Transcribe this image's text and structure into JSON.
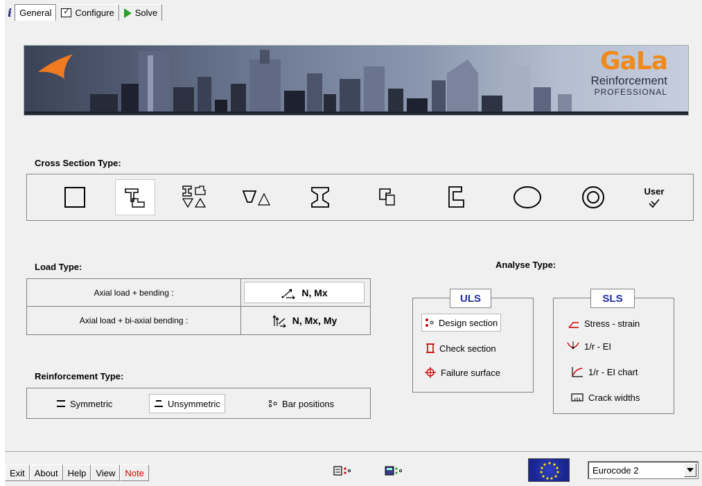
{
  "tabs": {
    "info_glyph": "i",
    "items": [
      {
        "label": "General",
        "icon": "none"
      },
      {
        "label": "Configure",
        "icon": "checklist-icon"
      },
      {
        "label": "Solve",
        "icon": "play-icon"
      }
    ]
  },
  "banner": {
    "brand_name": "GaLa",
    "brand_line1": "Reinforcement",
    "brand_line2": "PROFESSIONAL"
  },
  "cross_section": {
    "title": "Cross Section Type:",
    "user_label": "User",
    "items": [
      "rectangle-section-icon",
      "t-section-icon",
      "multi-section-icon",
      "trapezoid-section-icon",
      "i-section-icon",
      "box-section-icon",
      "l-section-icon",
      "circle-section-icon",
      "ring-section-icon",
      "user-section-icon"
    ],
    "selected": "t-section-icon"
  },
  "load_type": {
    "title": "Load Type:",
    "rows": [
      {
        "label": "Axial load + bending :",
        "button": "N, Mx"
      },
      {
        "label": "Axial load + bi-axial bending :",
        "button": "N, Mx, My"
      }
    ]
  },
  "reinforcement": {
    "title": "Reinforcement Type:",
    "items": [
      {
        "label": "Symmetric"
      },
      {
        "label": "Unsymmetric"
      },
      {
        "label": "Bar positions"
      }
    ]
  },
  "analyse": {
    "title": "Analyse Type:",
    "uls": {
      "title": "ULS",
      "items": [
        "Design section",
        "Check section",
        "Failure surface"
      ]
    },
    "sls": {
      "title": "SLS",
      "items": [
        "Stress - strain",
        "1/r - EI",
        "1/r - EI chart",
        "Crack widths"
      ]
    }
  },
  "footer": {
    "buttons": [
      "Exit",
      "About",
      "Help",
      "View",
      "Note"
    ],
    "code_select": "Eurocode 2"
  },
  "colors": {
    "accent_blue": "#1c2aa0",
    "brand_orange": "#f08a1c",
    "note_red": "#e00000",
    "play_green": "#2aa02a"
  }
}
